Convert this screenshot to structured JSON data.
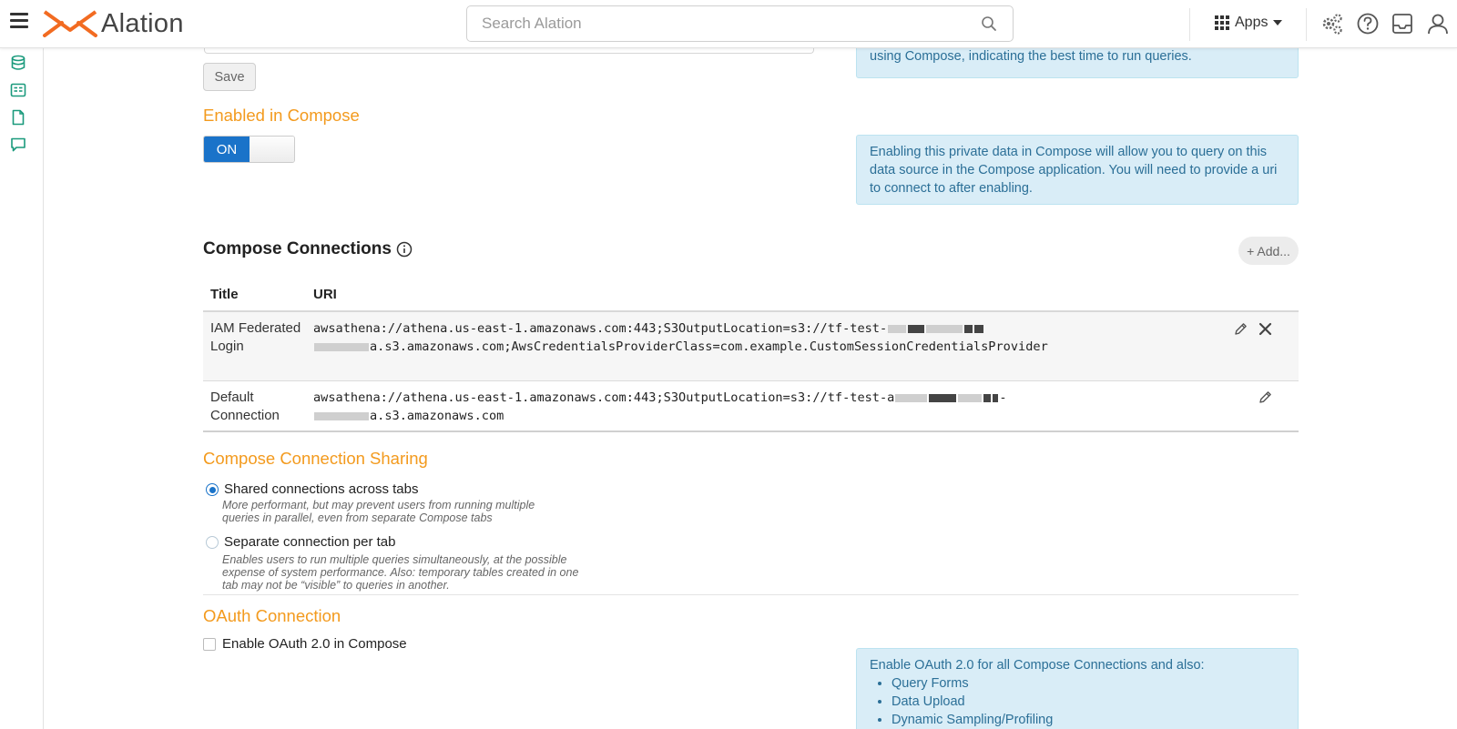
{
  "header": {
    "logo_text": "Alation",
    "search_placeholder": "Search Alation",
    "apps_label": "Apps"
  },
  "colors": {
    "accent_orange": "#f39a1d",
    "primary_blue": "#1a73c9",
    "info_bg": "#d9edf7",
    "info_text": "#2b6f97",
    "rail_icon": "#1a9a7c"
  },
  "rail": {
    "icons": [
      "database-icon",
      "catalog-icon",
      "document-icon",
      "conversation-icon"
    ]
  },
  "query_scheduling": {
    "info_partial": "using Compose, indicating the best time to run queries.",
    "save_label": "Save"
  },
  "enabled_in_compose": {
    "title": "Enabled in Compose",
    "toggle_on_label": "ON",
    "info": "Enabling this private data in Compose will allow you to query on this data source in the Compose application. You will need to provide a uri to connect to after enabling."
  },
  "compose_connections": {
    "title": "Compose Connections",
    "add_label": "+ Add...",
    "columns": [
      "Title",
      "URI"
    ],
    "rows": [
      {
        "title": "IAM Federated Login",
        "uri_line1": "awsathena://athena.us-east-1.amazonaws.com:443;S3OutputLocation=s3://tf-test-",
        "uri_line2_suffix": "a.s3.amazonaws.com;AwsCredentialsProviderClass=com.example.CustomSessionCredentialsProvider"
      },
      {
        "title": "Default Connection",
        "uri_line1": "awsathena://athena.us-east-1.amazonaws.com:443;S3OutputLocation=s3://tf-test-a",
        "uri_line1_end": "-",
        "uri_line2_suffix": "a.s3.amazonaws.com"
      }
    ]
  },
  "connection_sharing": {
    "title": "Compose Connection Sharing",
    "options": [
      {
        "label": "Shared connections across tabs",
        "desc_line1": "More performant, but may prevent users from running multiple",
        "desc_line2": "queries in parallel, even from separate Compose tabs",
        "selected": true
      },
      {
        "label": "Separate connection per tab",
        "desc_line1": "Enables users to run multiple queries simultaneously, at the possible",
        "desc_line2": "expense of system performance. Also: temporary tables created in one",
        "desc_line3": "tab may not be “visible” to queries in another.",
        "selected": false
      }
    ]
  },
  "oauth": {
    "title": "OAuth Connection",
    "checkbox_label": "Enable OAuth 2.0 in Compose",
    "info_intro": "Enable OAuth 2.0 for all Compose Connections and also:",
    "info_items": [
      "Query Forms",
      "Data Upload",
      "Dynamic Sampling/Profiling"
    ]
  }
}
